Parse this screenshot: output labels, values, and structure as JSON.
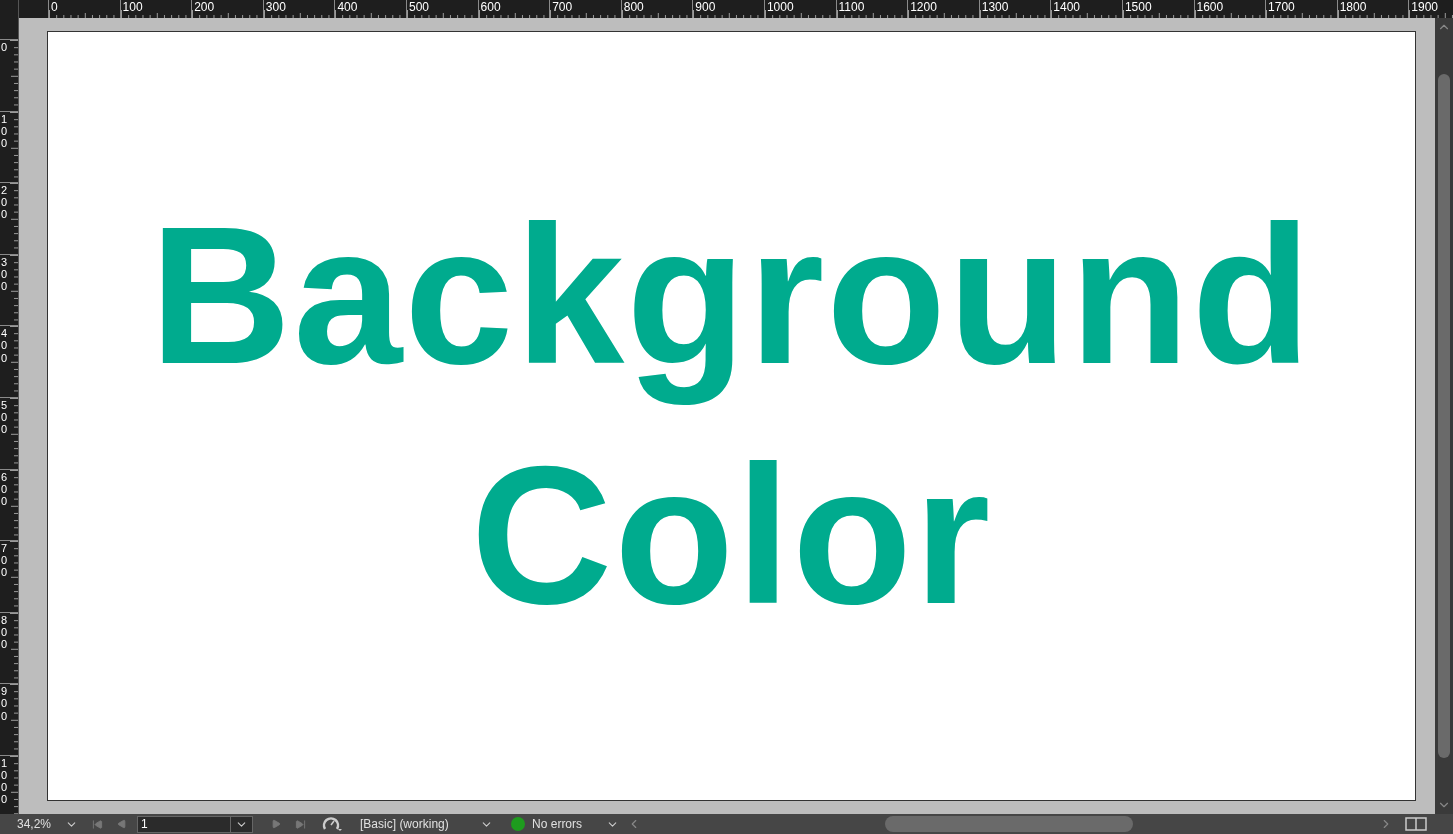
{
  "rulers": {
    "horizontal": [
      "0",
      "100",
      "200",
      "300",
      "400",
      "500",
      "600",
      "700",
      "800",
      "900",
      "1000",
      "1100",
      "1200",
      "1300",
      "1400",
      "1500",
      "1600",
      "1700",
      "1800",
      "1900"
    ],
    "vertical": [
      "0",
      "100",
      "200",
      "300",
      "400",
      "500",
      "600",
      "700",
      "800",
      "900",
      "1000"
    ]
  },
  "page": {
    "lines": [
      "Background",
      "Color"
    ]
  },
  "status_bar": {
    "zoom": "34,2%",
    "page_number": "1",
    "profile": "[Basic] (working)",
    "preflight": {
      "ok": true,
      "text": "No errors"
    }
  }
}
